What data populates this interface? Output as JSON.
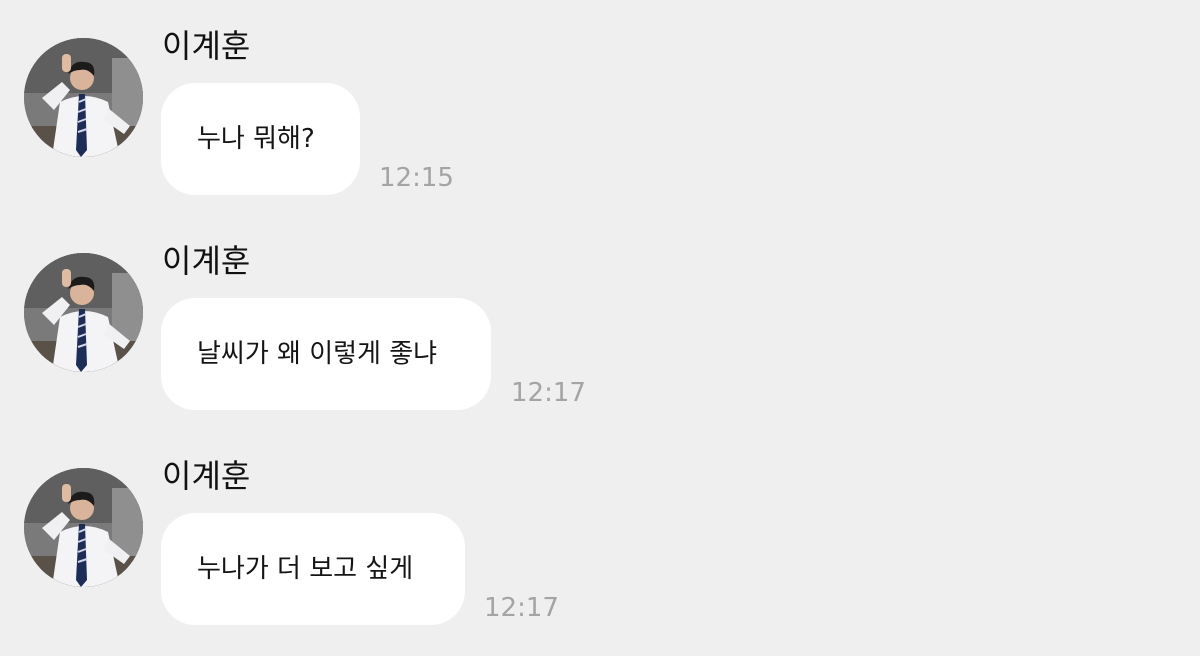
{
  "messages": [
    {
      "sender": "이계훈",
      "text": "누나 뭐해?",
      "time": "12:15",
      "avatar_icon": "profile-photo-avatar"
    },
    {
      "sender": "이계훈",
      "text": "날씨가 왜 이렇게 좋냐",
      "time": "12:17",
      "avatar_icon": "profile-photo-avatar"
    },
    {
      "sender": "이계훈",
      "text": "누나가 더 보고 싶게",
      "time": "12:17",
      "avatar_icon": "profile-photo-avatar"
    }
  ],
  "colors": {
    "background": "#efefef",
    "bubble": "#ffffff",
    "timestamp": "#a4a4a4",
    "text": "#151515"
  }
}
